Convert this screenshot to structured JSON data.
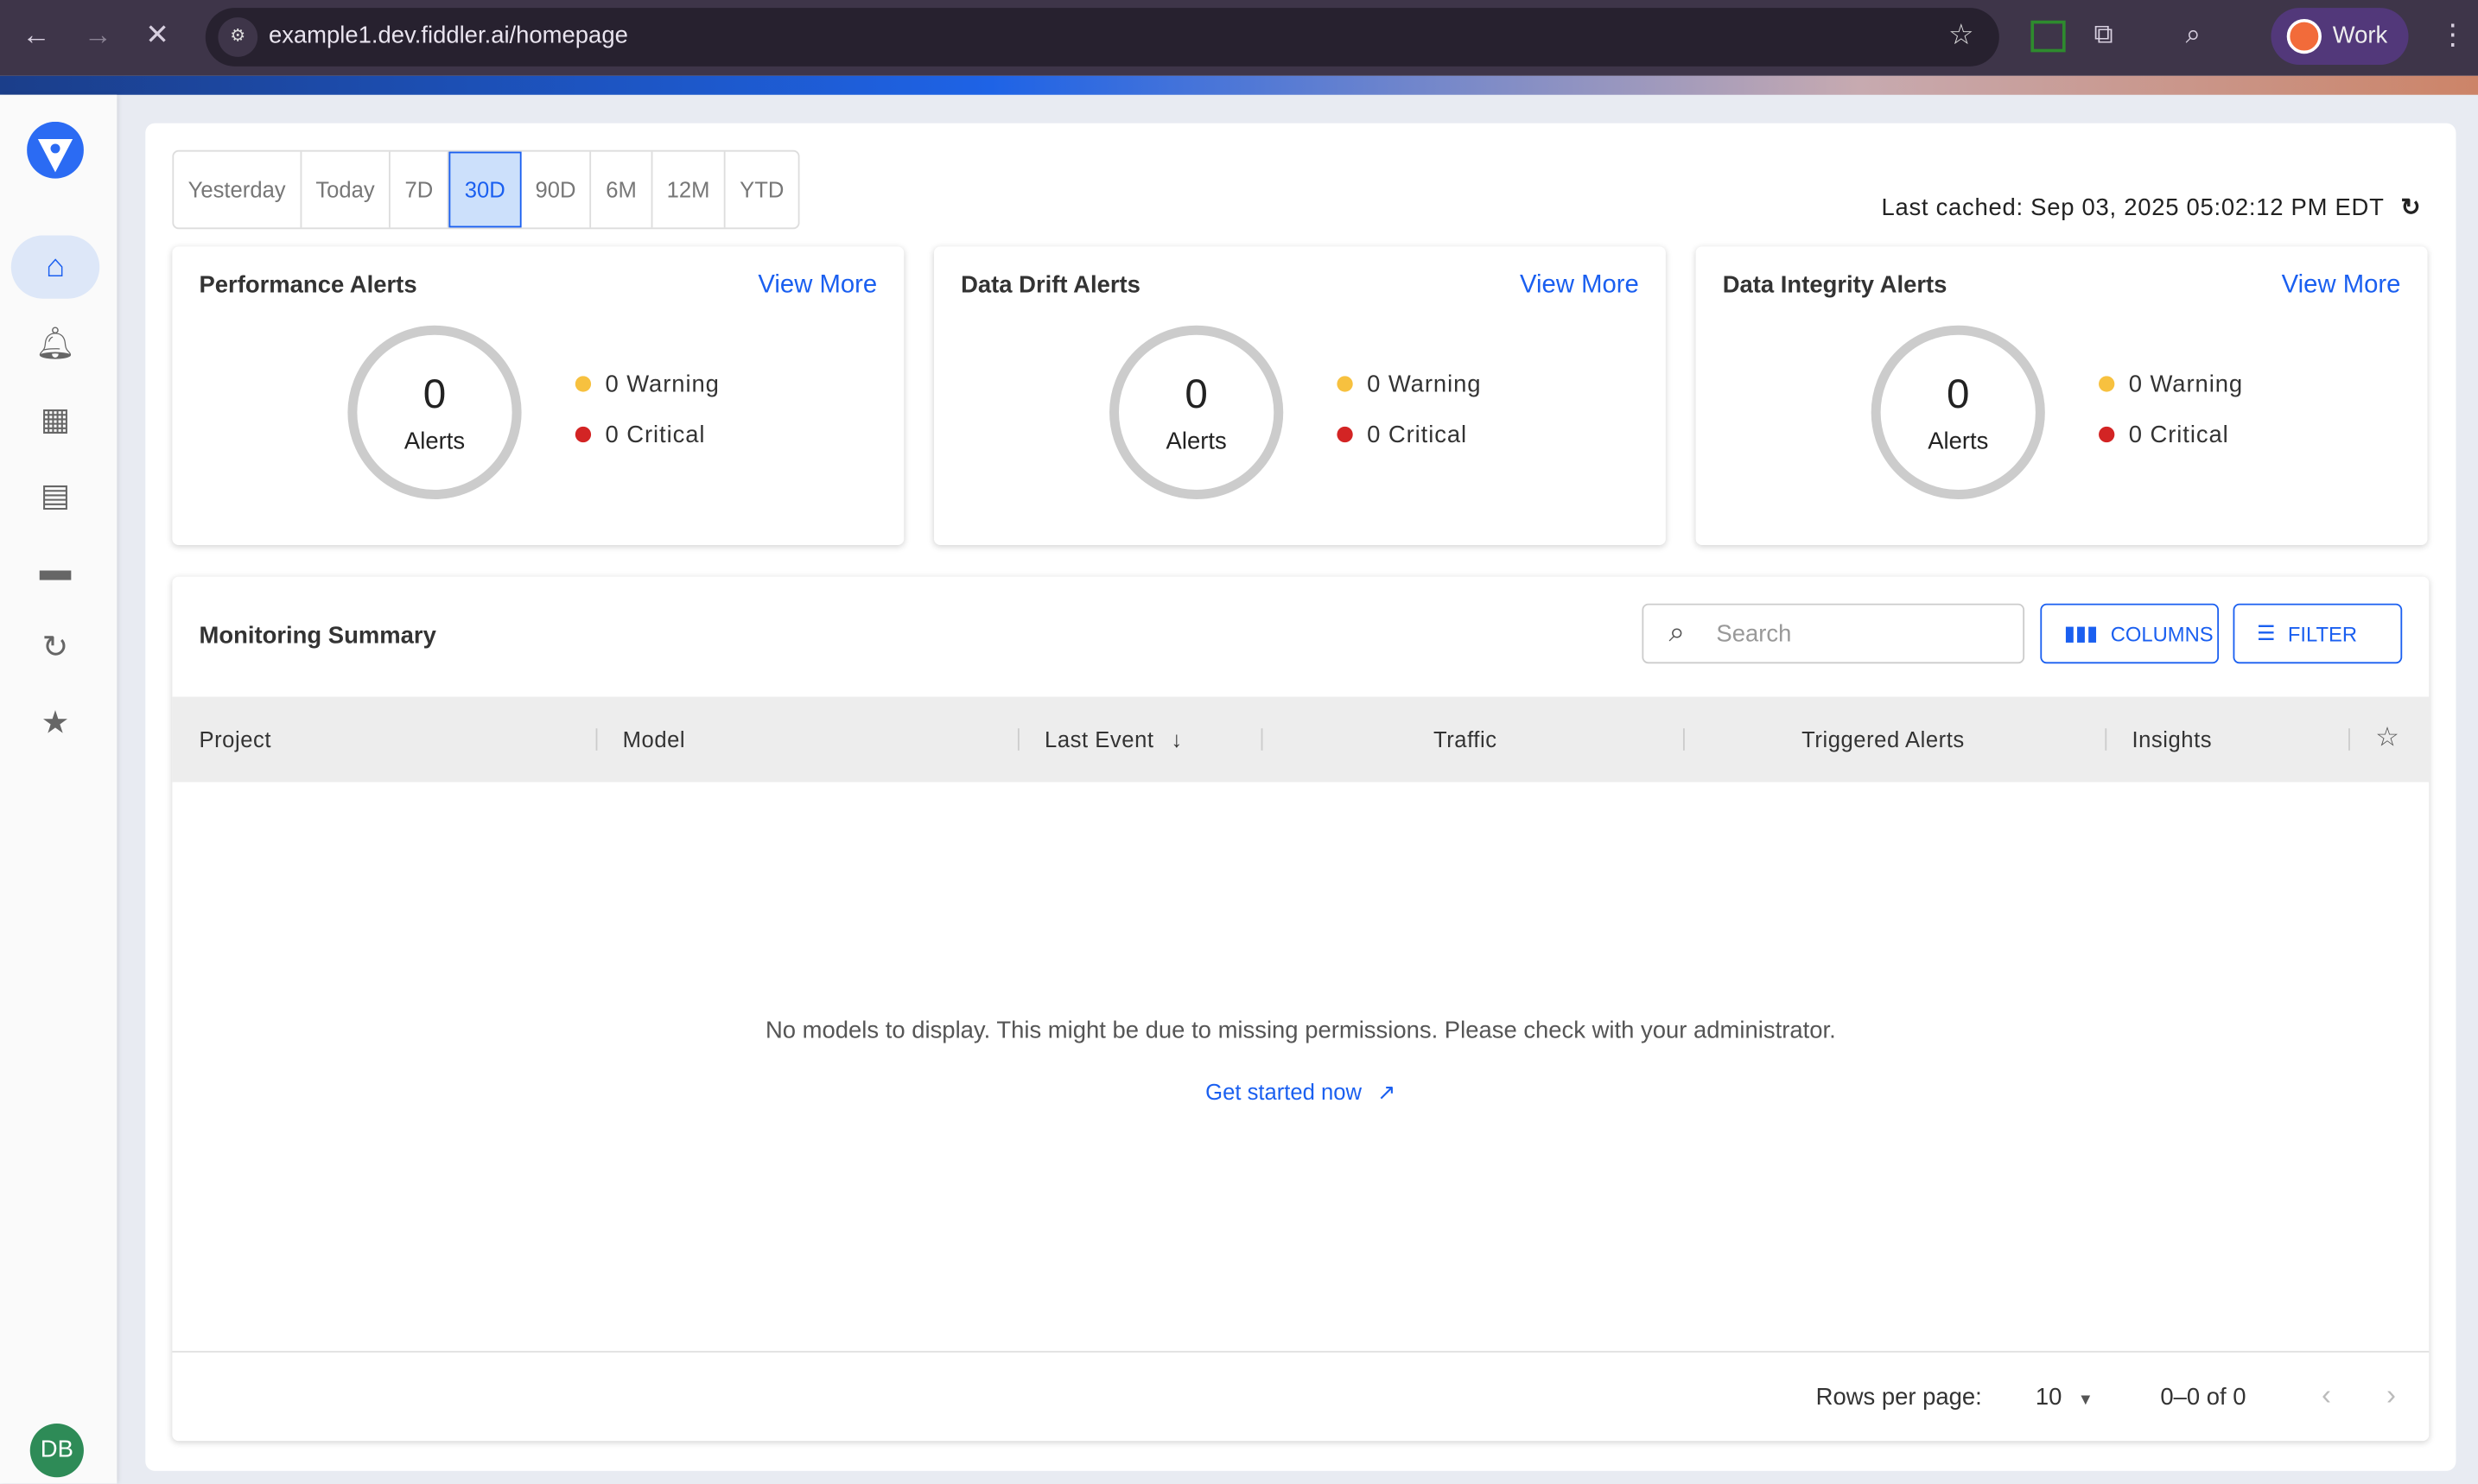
{
  "browser": {
    "url": "example1.dev.fiddler.ai/homepage",
    "profile": "Work"
  },
  "sidebar": {
    "avatar": "DB"
  },
  "ranges": [
    "Yesterday",
    "Today",
    "7D",
    "30D",
    "90D",
    "6M",
    "12M",
    "YTD"
  ],
  "selected_range": "30D",
  "last_cached": "Last cached: Sep 03, 2025 05:02:12 PM EDT",
  "cards": [
    {
      "title": "Performance Alerts",
      "view_more": "View More",
      "count": "0",
      "count_label": "Alerts",
      "warning": "0 Warning",
      "critical": "0 Critical"
    },
    {
      "title": "Data Drift Alerts",
      "view_more": "View More",
      "count": "0",
      "count_label": "Alerts",
      "warning": "0 Warning",
      "critical": "0 Critical"
    },
    {
      "title": "Data Integrity Alerts",
      "view_more": "View More",
      "count": "0",
      "count_label": "Alerts",
      "warning": "0 Warning",
      "critical": "0 Critical"
    }
  ],
  "summary": {
    "title": "Monitoring Summary",
    "search_placeholder": "Search",
    "columns_label": "COLUMNS",
    "filter_label": "FILTER",
    "headers": [
      "Project",
      "Model",
      "Last Event",
      "Traffic",
      "Triggered Alerts",
      "Insights"
    ],
    "empty": "No models to display. This might be due to missing permissions. Please check with your administrator.",
    "get_started": "Get started now",
    "rows_per_page_label": "Rows per page:",
    "rows_per_page": "10",
    "range": "0–0 of 0"
  },
  "colors": {
    "accent": "#1a5ff0",
    "warning": "#f7c13f",
    "critical": "#d32424"
  }
}
